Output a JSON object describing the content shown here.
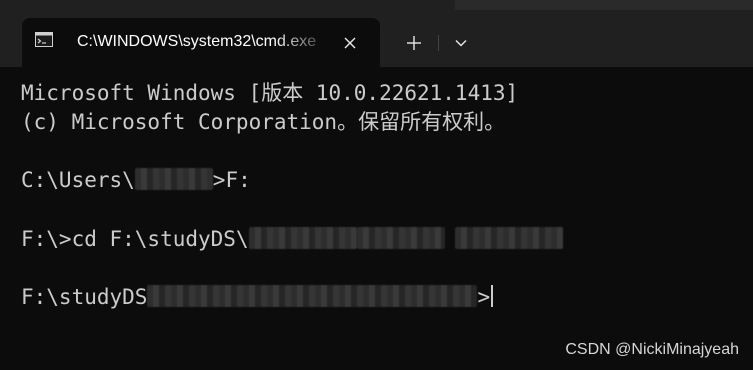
{
  "window": {
    "tab_title": "C:\\WINDOWS\\system32\\cmd.exe",
    "tab_icon": "command-prompt-icon",
    "close_icon": "close-icon",
    "new_tab_icon": "plus-icon",
    "dropdown_icon": "chevron-down-icon"
  },
  "terminal": {
    "lines": [
      "Microsoft Windows [版本 10.0.22621.1413]",
      "(c) Microsoft Corporation。保留所有权利。",
      "",
      {
        "before": "C:\\Users\\",
        "masked": true,
        "after": ">F:"
      },
      "",
      {
        "before": "F:\\>cd F:\\studyDS\\",
        "masked": true,
        "after": ""
      },
      "",
      {
        "before": "F:\\studyDS",
        "masked": true,
        "after": ">"
      }
    ],
    "line1": "Microsoft Windows [版本 10.0.22621.1413]",
    "line2": "(c) Microsoft Corporation。保留所有权利。",
    "line4_prefix": "C:\\Users\\",
    "line4_suffix": ">F:",
    "line6_prefix": "F:\\>cd F:\\studyDS\\",
    "line8_prefix": "F:\\studyDS",
    "line8_suffix": ">"
  },
  "watermark": "CSDN @NickiMinajyeah",
  "colors": {
    "titlebar": "#202020",
    "terminal_bg": "#0c0c0c",
    "terminal_text": "#cccccc"
  }
}
